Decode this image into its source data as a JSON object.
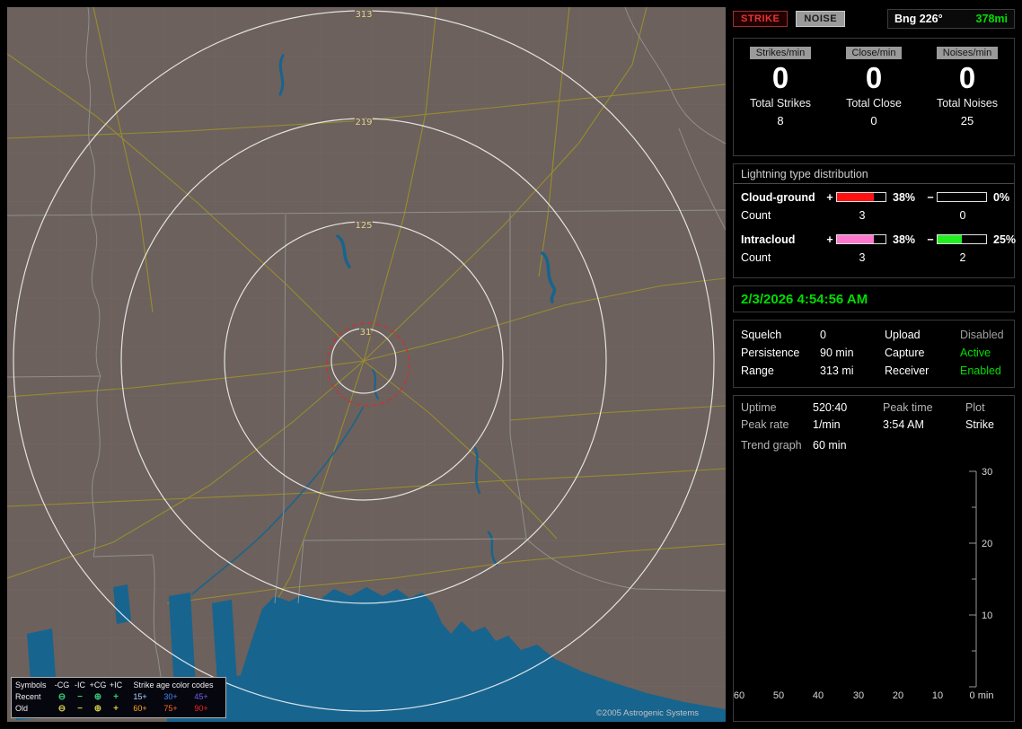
{
  "colors": {
    "green": "#00dd00"
  },
  "signs": {
    "plus": "+",
    "minus": "−"
  },
  "map": {
    "range_ring_labels": [
      "313",
      "219",
      "125",
      "31"
    ],
    "copyright": "©2005 Astrogenic Systems",
    "legend": {
      "symbols_header": "Symbols",
      "columns": [
        "-CG",
        "-IC",
        "+CG",
        "+IC"
      ],
      "age_header": "Strike age color codes",
      "rows": [
        {
          "label": "Recent",
          "symbols": [
            "⊖",
            "−",
            "⊕",
            "+"
          ],
          "symbol_color": "#33cc77",
          "ages": [
            {
              "t": "15+",
              "color": "#a8d4ff"
            },
            {
              "t": "30+",
              "color": "#4488ff"
            },
            {
              "t": "45+",
              "color": "#6f5fee"
            }
          ]
        },
        {
          "label": "Old",
          "symbols": [
            "⊖",
            "−",
            "⊕",
            "+"
          ],
          "symbol_color": "#cccc44",
          "ages": [
            {
              "t": "60+",
              "color": "#ffaa22"
            },
            {
              "t": "75+",
              "color": "#ff6622"
            },
            {
              "t": "90+",
              "color": "#ff2222"
            }
          ]
        }
      ]
    }
  },
  "panel": {
    "indicators": [
      {
        "label": "STRIKE"
      },
      {
        "label": "NOISE"
      }
    ],
    "bearing": {
      "label": "Bng 226°",
      "distance": "378mi"
    },
    "rates": [
      {
        "label": "Strikes/min",
        "value": "0",
        "total_label": "Total Strikes",
        "total": "8"
      },
      {
        "label": "Close/min",
        "value": "0",
        "total_label": "Total Close",
        "total": "0"
      },
      {
        "label": "Noises/min",
        "value": "0",
        "total_label": "Total Noises",
        "total": "25"
      }
    ],
    "distribution": {
      "title": "Lightning type distribution",
      "rows": [
        {
          "label": "Cloud-ground",
          "count_label": "Count",
          "plus_pct": "38%",
          "plus_fill": 76,
          "plus_color": "#ff1111",
          "plus_count": "3",
          "minus_pct": "0%",
          "minus_fill": 0,
          "minus_color": "#000000",
          "minus_count": "0"
        },
        {
          "label": "Intracloud",
          "count_label": "Count",
          "plus_pct": "38%",
          "plus_fill": 76,
          "plus_color": "#ff77cc",
          "plus_count": "3",
          "minus_pct": "25%",
          "minus_fill": 50,
          "minus_color": "#22ee22",
          "minus_count": "2"
        }
      ]
    },
    "datetime": "2/3/2026 4:54:56 AM",
    "settings": {
      "left": [
        {
          "label": "Squelch",
          "value": "0"
        },
        {
          "label": "Persistence",
          "value": "90 min"
        },
        {
          "label": "Range",
          "value": "313 mi"
        }
      ],
      "right": [
        {
          "label": "Upload",
          "value": "Disabled",
          "color": "#a0a0a0"
        },
        {
          "label": "Capture",
          "value": "Active",
          "color": "#00dd00"
        },
        {
          "label": "Receiver",
          "value": "Enabled",
          "color": "#00dd00"
        }
      ]
    },
    "status": {
      "uptime_label": "Uptime",
      "uptime_value": "520:40",
      "peak_rate_label": "Peak rate",
      "peak_rate_value": "1/min",
      "peak_time_label": "Peak time",
      "peak_time_value": "3:54 AM",
      "plot_label": "Plot",
      "plot_value": "Strike",
      "trend_label": "Trend graph",
      "trend_value": "60 min"
    },
    "trend_chart": {
      "y_ticks": [
        "30",
        "20",
        "10"
      ],
      "x_ticks": [
        "60",
        "50",
        "40",
        "30",
        "20",
        "10"
      ],
      "x_end_label": "0 min"
    }
  }
}
